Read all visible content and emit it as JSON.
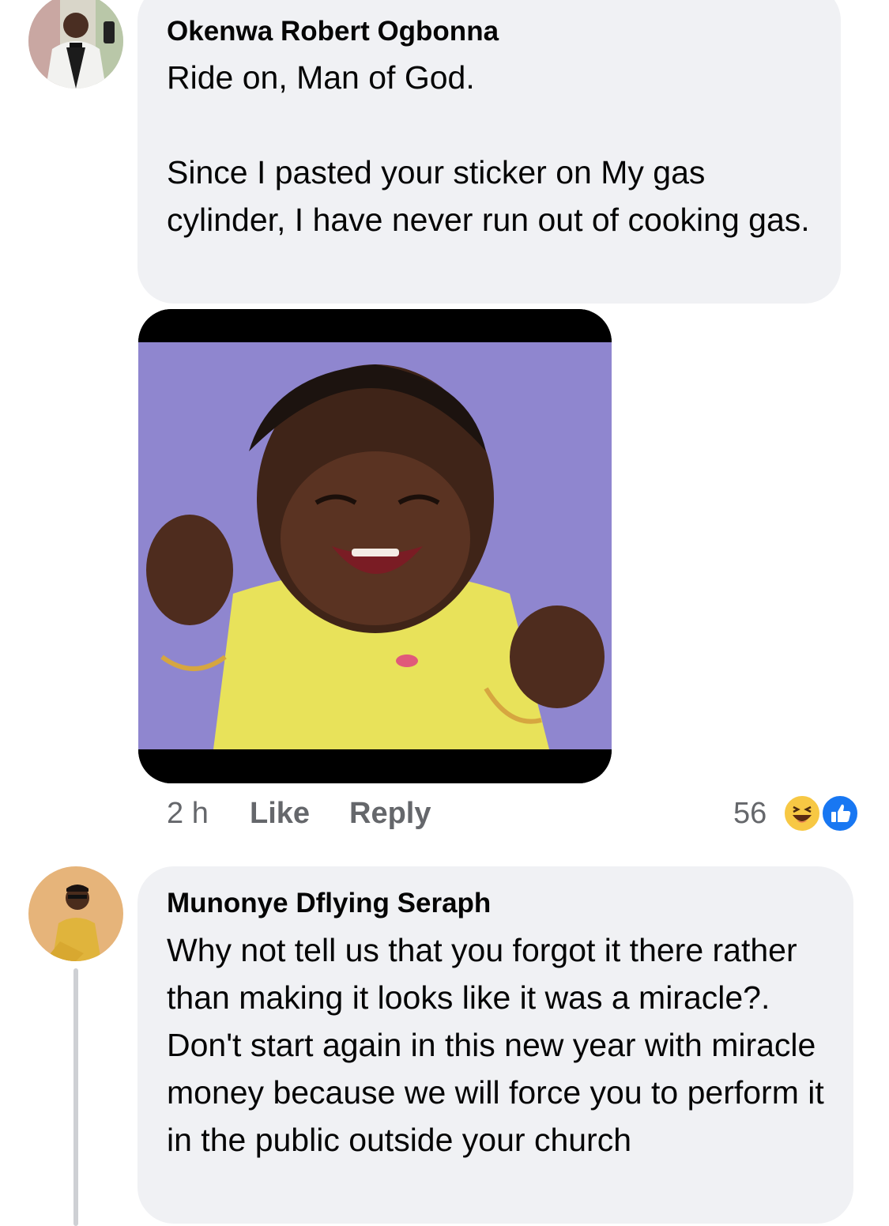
{
  "comments": [
    {
      "author": "Okenwa Robert Ogbonna",
      "text": "Ride on, Man of God.\n\nSince I pasted your sticker on My gas cylinder, I have never run out of cooking gas.",
      "meta": {
        "time": "2 h",
        "like_label": "Like",
        "reply_label": "Reply",
        "reaction_count": "56",
        "reaction_icons": [
          "haha-emoji-icon",
          "like-thumb-icon"
        ]
      },
      "attachment": "laughing-child-meme-image"
    },
    {
      "author": "Munonye Dflying Seraph",
      "text": "Why not tell us that you forgot it there rather than making it looks like it was a miracle?. Don't start again in this new year with miracle money because we will force you to perform it in the public outside your church"
    }
  ],
  "colors": {
    "bubble_bg": "#f0f1f4",
    "meta_text": "#65676b",
    "like_blue": "#1877f2",
    "haha_yellow": "#f7c844",
    "thread_line": "#ced0d4"
  }
}
